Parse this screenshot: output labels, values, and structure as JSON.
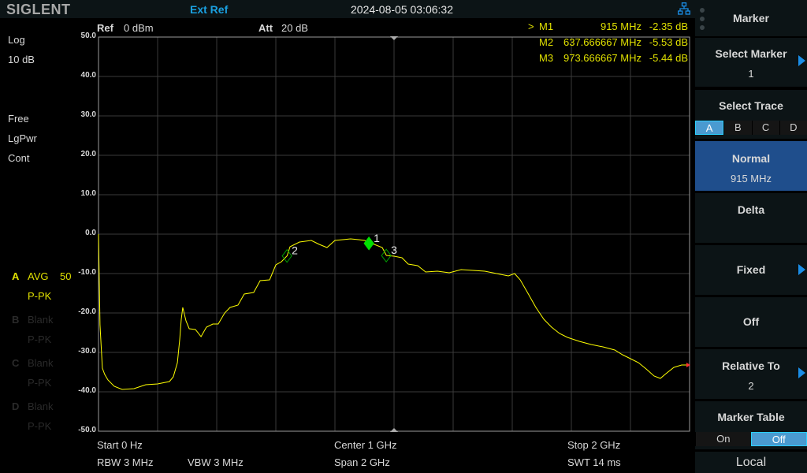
{
  "topbar": {
    "logo": "SIGLENT",
    "ref_source": "Ext Ref",
    "datetime": "2024-08-05 03:06:32",
    "network_icon": "network-icon"
  },
  "header": {
    "ref_label": "Ref",
    "ref_value": "0 dBm",
    "att_label": "Att",
    "att_value": "20 dB"
  },
  "left": {
    "scale_type": "Log",
    "scale_div": "10 dB",
    "trig": "Free",
    "detector": "LgPwr",
    "sweep": "Cont",
    "traces": [
      {
        "id": "A",
        "mode": "AVG",
        "count": "50",
        "det": "P-PK",
        "active": true
      },
      {
        "id": "B",
        "mode": "Blank",
        "det": "P-PK",
        "active": false
      },
      {
        "id": "C",
        "mode": "Blank",
        "det": "P-PK",
        "active": false
      },
      {
        "id": "D",
        "mode": "Blank",
        "det": "P-PK",
        "active": false
      }
    ]
  },
  "markers": [
    {
      "sel": ">",
      "name": "M1",
      "freq": "915 MHz",
      "value": "-2.35 dB"
    },
    {
      "name": "M2",
      "freq": "637.666667 MHz",
      "value": "-5.53 dB"
    },
    {
      "name": "M3",
      "freq": "973.666667 MHz",
      "value": "-5.44 dB"
    }
  ],
  "footer": {
    "start": "Start  0 Hz",
    "center": "Center  1 GHz",
    "stop": "Stop  2 GHz",
    "rbw": "RBW  3 MHz",
    "vbw": "VBW  3 MHz",
    "span": "Span  2 GHz",
    "swt": "SWT  14 ms"
  },
  "panel": {
    "title": "Marker",
    "select_marker": {
      "label": "Select Marker",
      "value": "1"
    },
    "select_trace": {
      "label": "Select Trace",
      "options": [
        "A",
        "B",
        "C",
        "D"
      ],
      "selected": "A"
    },
    "normal": {
      "label": "Normal",
      "value": "915 MHz"
    },
    "delta": "Delta",
    "fixed": "Fixed",
    "off": "Off",
    "relative_to": {
      "label": "Relative To",
      "value": "2"
    },
    "marker_table": {
      "label": "Marker Table",
      "on": "On",
      "off": "Off",
      "selected": "Off"
    },
    "local": "Local"
  },
  "colors": {
    "trace": "#ffff00",
    "marker_active": "#00e000",
    "marker": "#00a000",
    "accent": "#1a8ee8",
    "selected_button": "#1f4e8c"
  },
  "chart_data": {
    "type": "line",
    "xlabel": "",
    "ylabel": "",
    "xlim": [
      0,
      2000
    ],
    "ylim": [
      -50,
      50
    ],
    "x_unit": "MHz",
    "y_unit": "dBm",
    "grid": true,
    "yticks": [
      "50.0",
      "40.0",
      "30.0",
      "20.0",
      "10.0",
      "0.0",
      "-10.0",
      "-20.0",
      "-30.0",
      "-40.0",
      "-50.0"
    ],
    "trace": [
      [
        0,
        0
      ],
      [
        5,
        -23
      ],
      [
        13,
        -34
      ],
      [
        21,
        -35.6
      ],
      [
        32,
        -37
      ],
      [
        53,
        -38.6
      ],
      [
        80,
        -39.4
      ],
      [
        120,
        -39.2
      ],
      [
        160,
        -38.2
      ],
      [
        200,
        -38
      ],
      [
        240,
        -37.4
      ],
      [
        253,
        -36.2
      ],
      [
        267,
        -32.6
      ],
      [
        275,
        -26.6
      ],
      [
        280,
        -21.6
      ],
      [
        285,
        -18.6
      ],
      [
        296,
        -22
      ],
      [
        307,
        -24
      ],
      [
        328,
        -24.2
      ],
      [
        347,
        -26
      ],
      [
        365,
        -23.6
      ],
      [
        387,
        -22.8
      ],
      [
        405,
        -22.8
      ],
      [
        427,
        -20
      ],
      [
        445,
        -18.6
      ],
      [
        472,
        -18
      ],
      [
        493,
        -15.2
      ],
      [
        525,
        -14.8
      ],
      [
        547,
        -11.8
      ],
      [
        579,
        -11.6
      ],
      [
        600,
        -7.8
      ],
      [
        619,
        -7
      ],
      [
        638,
        -5.5
      ],
      [
        648,
        -3.2
      ],
      [
        680,
        -2
      ],
      [
        720,
        -1.6
      ],
      [
        747,
        -2.6
      ],
      [
        773,
        -3.4
      ],
      [
        800,
        -1.6
      ],
      [
        827,
        -1.4
      ],
      [
        853,
        -1.2
      ],
      [
        880,
        -1.4
      ],
      [
        901,
        -1.6
      ],
      [
        915,
        -2.35
      ],
      [
        933,
        -2.6
      ],
      [
        960,
        -3.4
      ],
      [
        974,
        -5.4
      ],
      [
        1000,
        -5.6
      ],
      [
        1027,
        -6
      ],
      [
        1048,
        -7.6
      ],
      [
        1080,
        -8
      ],
      [
        1107,
        -9.6
      ],
      [
        1147,
        -9.4
      ],
      [
        1187,
        -9.8
      ],
      [
        1227,
        -9
      ],
      [
        1267,
        -9.2
      ],
      [
        1307,
        -9.4
      ],
      [
        1347,
        -10
      ],
      [
        1387,
        -10.6
      ],
      [
        1408,
        -10
      ],
      [
        1427,
        -11.6
      ],
      [
        1453,
        -15
      ],
      [
        1480,
        -18.6
      ],
      [
        1507,
        -21.6
      ],
      [
        1533,
        -23.6
      ],
      [
        1560,
        -25.2
      ],
      [
        1587,
        -26.2
      ],
      [
        1627,
        -27.2
      ],
      [
        1667,
        -28
      ],
      [
        1707,
        -28.6
      ],
      [
        1747,
        -29.4
      ],
      [
        1773,
        -30.6
      ],
      [
        1800,
        -31.6
      ],
      [
        1827,
        -32.6
      ],
      [
        1853,
        -34.2
      ],
      [
        1880,
        -36
      ],
      [
        1901,
        -36.6
      ],
      [
        1920,
        -35.4
      ],
      [
        1947,
        -33.8
      ],
      [
        1973,
        -33.2
      ],
      [
        2000,
        -33.2
      ]
    ],
    "marker_points": [
      {
        "label": "1",
        "x": 915,
        "y": -2.35,
        "active": true
      },
      {
        "label": "2",
        "x": 637.666667,
        "y": -5.53
      },
      {
        "label": "3",
        "x": 973.666667,
        "y": -5.44
      }
    ]
  }
}
